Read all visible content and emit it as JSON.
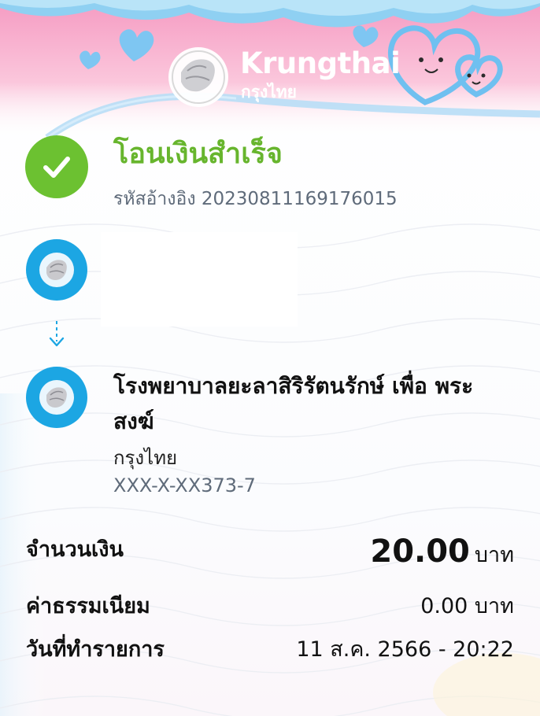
{
  "brand": {
    "name": "Krungthai",
    "name_thai": "กรุงไทย"
  },
  "status": {
    "title": "โอนเงินสำเร็จ",
    "ref_label": "รหัสอ้างอิง",
    "ref_number": "20230811169176015",
    "icon": "check-icon",
    "color": "#6cc131"
  },
  "sender": {
    "icon": "krungthai-logo-icon"
  },
  "recipient": {
    "name": "โรงพยาบาลยะลาสิริรัตนรักษ์ เพื่อ พระสงฆ์",
    "bank": "กรุงไทย",
    "account": "XXX-X-XX373-7",
    "icon": "krungthai-logo-icon"
  },
  "details": {
    "amount_label": "จำนวนเงิน",
    "amount_value": "20.00",
    "amount_unit": "บาท",
    "fee_label": "ค่าธรรมเนียม",
    "fee_value": "0.00 บาท",
    "date_label": "วันที่ทำรายการ",
    "date_value": "11 ส.ค. 2566 - 20:22"
  },
  "colors": {
    "accent_blue": "#1ca6e3",
    "success_green": "#67b52d",
    "header_pink": "#f7a8c8"
  }
}
